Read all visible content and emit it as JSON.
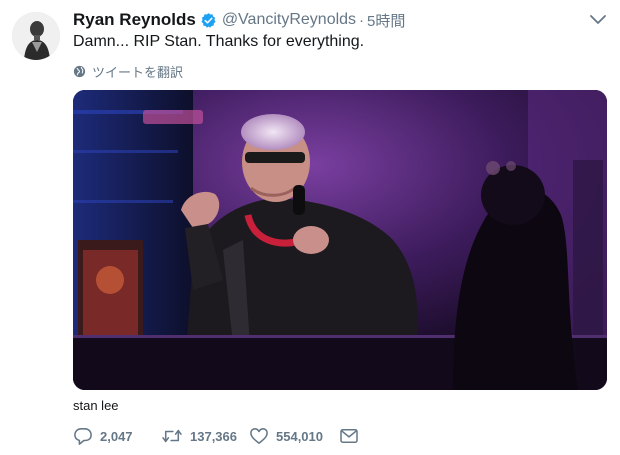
{
  "tweet": {
    "author_name": "Ryan Reynolds",
    "author_handle": "@VancityReynolds",
    "separator": "·",
    "timestamp": "5時間",
    "text": "Damn... RIP Stan. Thanks for everything.",
    "translate_label": "ツイートを翻訳",
    "media_caption": "stan lee"
  },
  "icons": {
    "verified": "verified-badge-icon",
    "caret": "chevron-down-icon",
    "translate": "globe-icon",
    "reply": "reply-icon",
    "retweet": "retweet-icon",
    "like": "heart-icon",
    "message": "envelope-icon"
  },
  "actions": {
    "reply_count": "2,047",
    "retweet_count": "137,366",
    "like_count": "554,010"
  },
  "colors": {
    "verified_blue": "#1da1f2",
    "secondary_text": "#657786",
    "primary_text": "#14171a"
  }
}
